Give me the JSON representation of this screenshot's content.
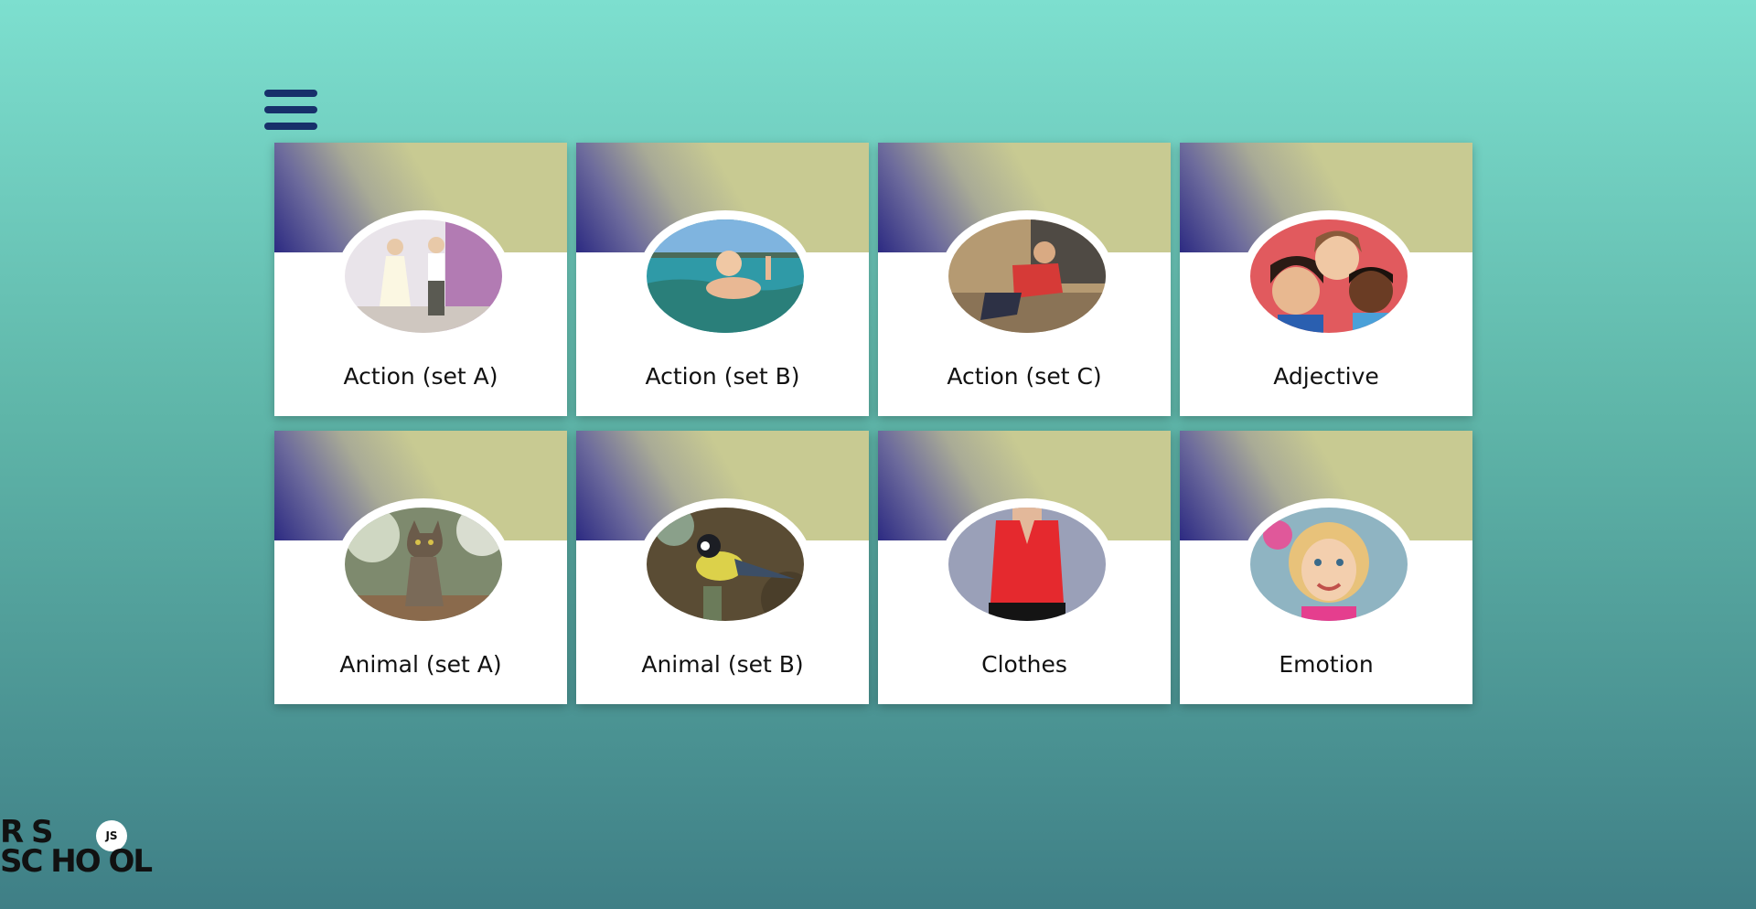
{
  "menu": {
    "icon": "hamburger-icon"
  },
  "cards": [
    {
      "label": "Action (set A)",
      "icon": "dancing-kids-photo"
    },
    {
      "label": "Action (set B)",
      "icon": "swimming-boy-photo"
    },
    {
      "label": "Action (set C)",
      "icon": "crawling-boy-photo"
    },
    {
      "label": "Adjective",
      "icon": "smiling-children-photo"
    },
    {
      "label": "Animal (set A)",
      "icon": "cat-photo"
    },
    {
      "label": "Animal (set B)",
      "icon": "bird-photo"
    },
    {
      "label": "Clothes",
      "icon": "red-blouse-photo"
    },
    {
      "label": "Emotion",
      "icon": "smiling-girl-photo"
    }
  ],
  "logo": {
    "line1": "R   S",
    "line2": "SC HO OL",
    "badge": "JS"
  },
  "colors": {
    "menu": "#17306a",
    "card_band_light": "#c8ca92",
    "card_band_dark": "#2c2a82",
    "card_body": "#ffffff",
    "background_top": "#7ddfcf",
    "background_bottom": "#3f7f86"
  }
}
